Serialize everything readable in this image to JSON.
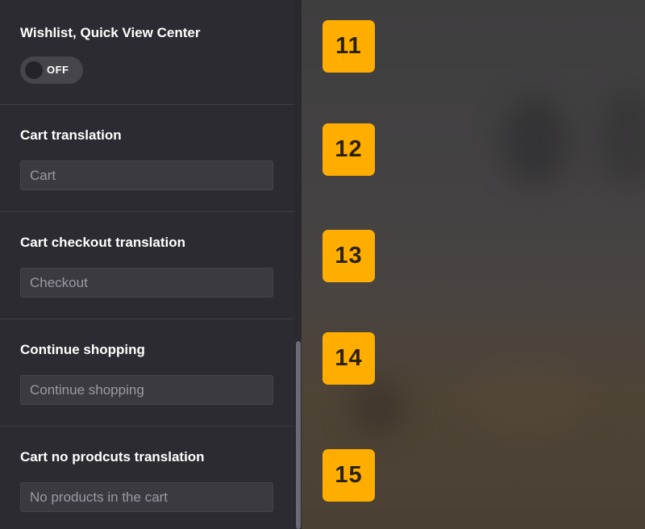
{
  "settings": {
    "wishlist": {
      "label": "Wishlist, Quick View Center",
      "toggle_state": "OFF"
    },
    "cart": {
      "label": "Cart translation",
      "value": "Cart"
    },
    "checkout": {
      "label": "Cart checkout translation",
      "value": "Checkout"
    },
    "continue_shopping": {
      "label": "Continue shopping",
      "value": "Continue shopping"
    },
    "no_products": {
      "label": "Cart no prodcuts translation",
      "value": "No products in the cart"
    }
  },
  "badges": [
    "11",
    "12",
    "13",
    "14",
    "15"
  ],
  "colors": {
    "panel_bg": "#2c2b31",
    "field_bg": "#3b3a41",
    "badge": "#ffae00",
    "label_text": "#ffffff",
    "value_text": "#9b9aa3"
  }
}
